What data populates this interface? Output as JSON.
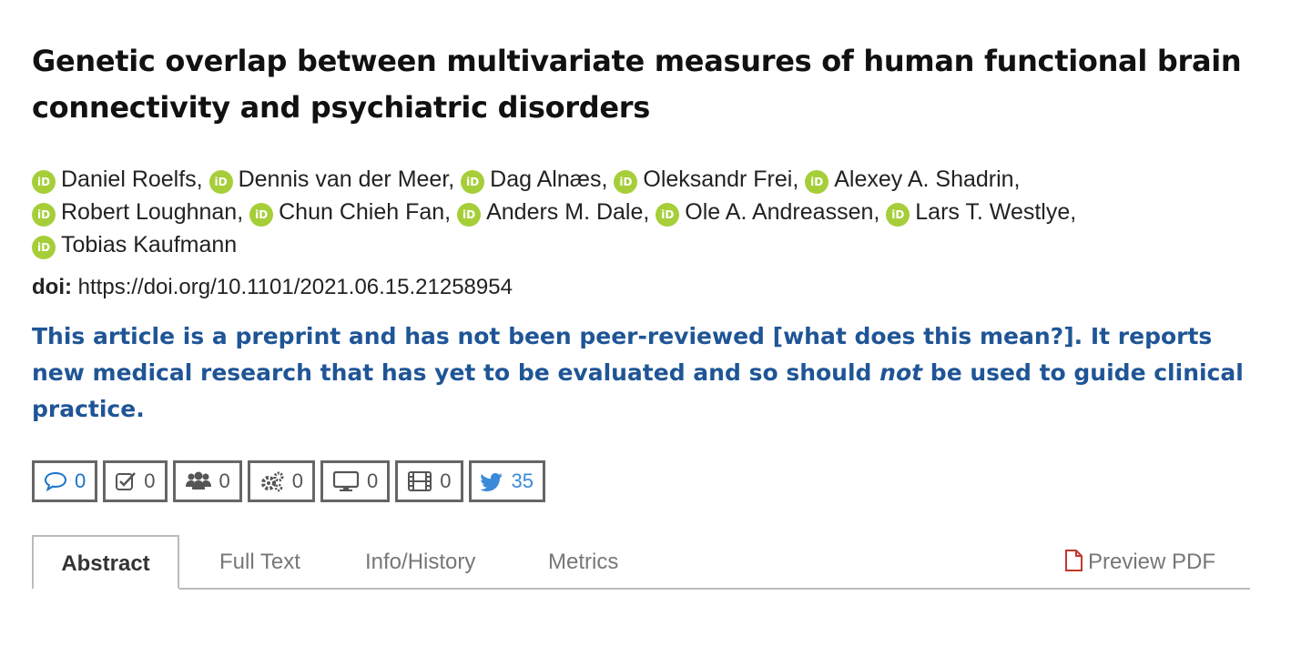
{
  "title": "Genetic overlap between multivariate measures of human functional brain connectivity and psychiatric disorders",
  "orcid_label": "iD",
  "authors": [
    "Daniel Roelfs,",
    "Dennis van der Meer,",
    "Dag Alnæs,",
    "Oleksandr Frei,",
    "Alexey A. Shadrin,",
    "Robert Loughnan,",
    "Chun Chieh Fan,",
    "Anders M. Dale,",
    "Ole A. Andreassen,",
    "Lars T. Westlye,",
    "Tobias Kaufmann"
  ],
  "doi": {
    "label": "doi:",
    "value": "https://doi.org/10.1101/2021.06.15.21258954"
  },
  "notice": {
    "part1": "This article is a preprint and has not been peer-reviewed ",
    "link": "[what does this mean?]",
    "part2": ". It reports new medical research that has yet to be evaluated and so should ",
    "emph": "not",
    "part3": " be used to guide clinical practice."
  },
  "badges": [
    {
      "icon": "comment-icon",
      "count": "0",
      "color": "#1a73c8"
    },
    {
      "icon": "checkbox-icon",
      "count": "0",
      "color": "#555555"
    },
    {
      "icon": "users-icon",
      "count": "0",
      "color": "#555555"
    },
    {
      "icon": "gears-icon",
      "count": "0",
      "color": "#555555"
    },
    {
      "icon": "monitor-icon",
      "count": "0",
      "color": "#555555"
    },
    {
      "icon": "film-icon",
      "count": "0",
      "color": "#555555"
    },
    {
      "icon": "twitter-icon",
      "count": "35",
      "color": "#3b8ad9"
    }
  ],
  "tabs": {
    "abstract": "Abstract",
    "full_text": "Full Text",
    "info_history": "Info/History",
    "metrics": "Metrics",
    "preview_pdf": "Preview PDF"
  },
  "colors": {
    "notice": "#1f5596",
    "orcid": "#a6ce39",
    "pdf_icon": "#c0392b"
  }
}
